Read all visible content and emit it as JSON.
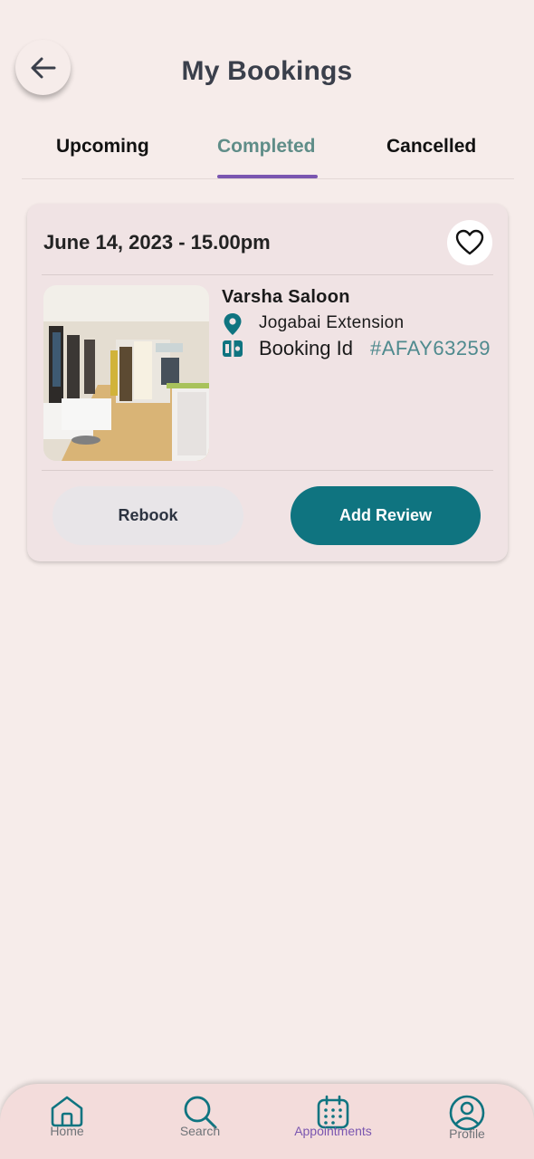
{
  "header": {
    "title": "My Bookings",
    "back_icon": "arrow-left-icon"
  },
  "tabs": [
    {
      "label": "Upcoming",
      "active": false
    },
    {
      "label": "Completed",
      "active": true
    },
    {
      "label": "Cancelled",
      "active": false
    }
  ],
  "booking": {
    "date_time": "June 14, 2023 - 15.00pm",
    "salon_name": "Varsha Saloon",
    "location": "Jogabai Extension",
    "booking_id_label": "Booking Id",
    "booking_id": "#AFAY63259",
    "favorite_icon": "heart-outline-icon",
    "rebook_label": "Rebook",
    "review_label": "Add Review"
  },
  "nav": [
    {
      "label": "Home",
      "icon": "home-icon",
      "active": false
    },
    {
      "label": "Search",
      "icon": "search-icon",
      "active": false
    },
    {
      "label": "Appointments",
      "icon": "calendar-icon",
      "active": true
    },
    {
      "label": "Profile",
      "icon": "profile-icon",
      "active": false
    }
  ],
  "colors": {
    "background": "#f6ecea",
    "accent_teal": "#0f7480",
    "active_purple": "#7a56b0",
    "tab_active_text": "#5f8d88"
  }
}
